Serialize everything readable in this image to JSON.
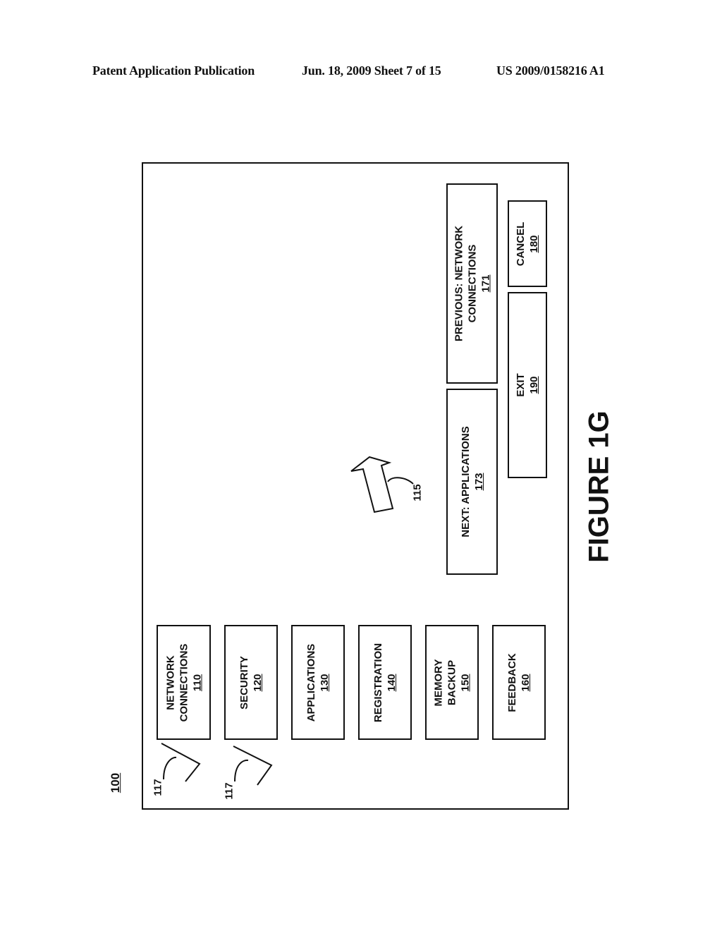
{
  "header": {
    "publication": "Patent Application Publication",
    "date_sheet": "Jun. 18, 2009  Sheet 7 of 15",
    "number": "US 2009/0158216 A1"
  },
  "figure": {
    "ref": "100",
    "caption": "FIGURE 1G",
    "menu_items": [
      {
        "label": "NETWORK\nCONNECTIONS",
        "line1": "NETWORK",
        "line2": "CONNECTIONS",
        "num": "110"
      },
      {
        "label": "SECURITY",
        "line1": "SECURITY",
        "num": "120"
      },
      {
        "label": "APPLICATIONS",
        "line1": "APPLICATIONS",
        "num": "130"
      },
      {
        "label": "REGISTRATION",
        "line1": "REGISTRATION",
        "num": "140"
      },
      {
        "label": "MEMORY BACKUP",
        "line1": "MEMORY",
        "line2": "BACKUP",
        "num": "150"
      },
      {
        "label": "FEEDBACK",
        "line1": "FEEDBACK",
        "num": "160"
      }
    ],
    "check_ref": "117",
    "pointer_ref": "115",
    "next_button": {
      "line1": "NEXT:  APPLICATIONS",
      "num": "173"
    },
    "previous_button": {
      "line1": "PREVIOUS: NETWORK",
      "line2": "CONNECTIONS",
      "num": "171"
    },
    "exit_button": {
      "line1": "EXIT",
      "num": "190"
    },
    "cancel_button": {
      "line1": "CANCEL",
      "num": "180"
    }
  }
}
